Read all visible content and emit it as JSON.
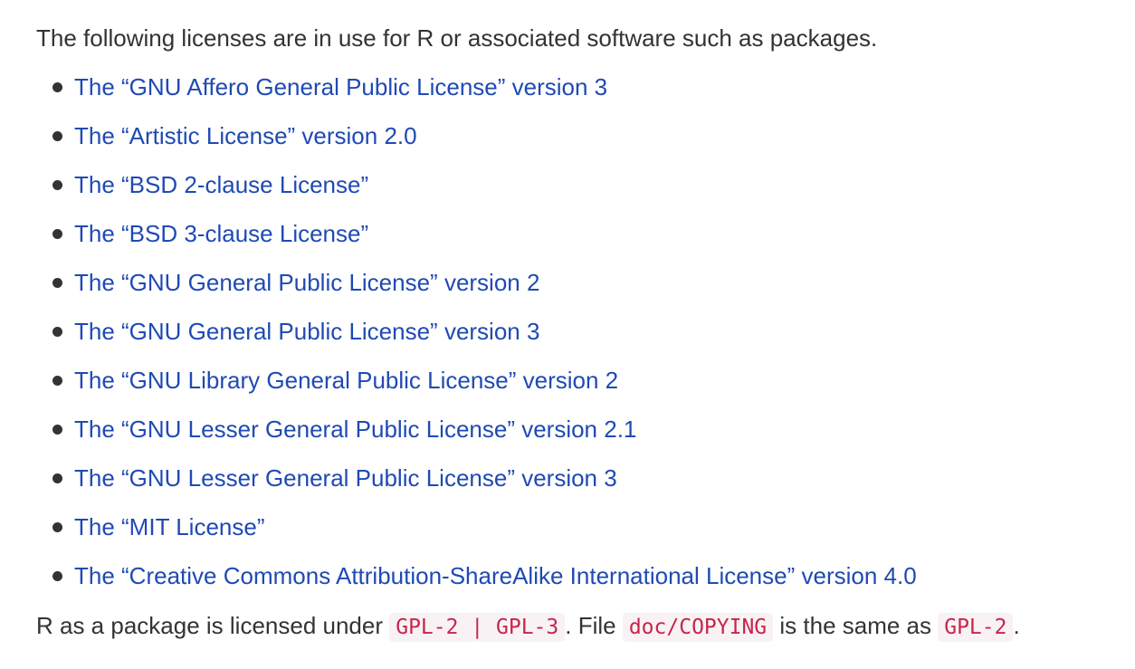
{
  "intro": "The following licenses are in use for R or associated software such as packages.",
  "licenses": [
    "The “GNU Affero General Public License” version 3",
    "The “Artistic License” version 2.0",
    "The “BSD 2-clause License”",
    "The “BSD 3-clause License”",
    "The “GNU General Public License” version 2",
    "The “GNU General Public License” version 3",
    "The “GNU Library General Public License” version 2",
    "The “GNU Lesser General Public License” version 2.1",
    "The “GNU Lesser General Public License” version 3",
    "The “MIT License”",
    "The “Creative Commons Attribution-ShareAlike International License” version 4.0"
  ],
  "footer": {
    "part1": "R as a package is licensed under ",
    "code1": "GPL-2 | GPL-3",
    "part2": ". File ",
    "code2": "doc/COPYING",
    "part3": " is the same as ",
    "code3": "GPL-2",
    "part4": "."
  },
  "colors": {
    "link": "#1f4ab4",
    "text": "#333333",
    "code_text": "#c7254e",
    "code_bg": "#f9f2f4"
  }
}
